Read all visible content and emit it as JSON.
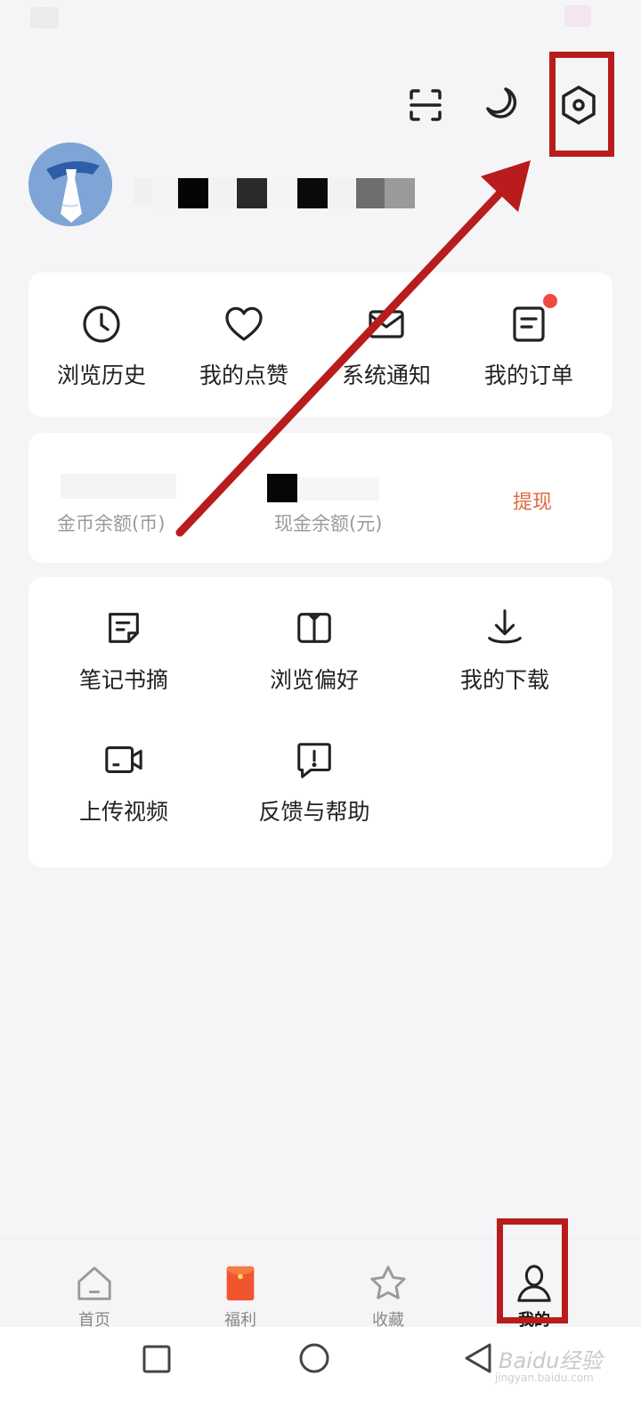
{
  "header": {
    "username_masked": "",
    "icons": [
      "scan-icon",
      "moon-icon",
      "settings-icon"
    ]
  },
  "quick_actions": [
    {
      "label": "浏览历史",
      "icon": "clock-icon"
    },
    {
      "label": "我的点赞",
      "icon": "heart-icon"
    },
    {
      "label": "系统通知",
      "icon": "mail-icon"
    },
    {
      "label": "我的订单",
      "icon": "order-icon",
      "badge": true
    }
  ],
  "wallet": {
    "coin_label": "金币余额(币)",
    "cash_label": "现金余额(元)",
    "withdraw_label": "提现"
  },
  "features": [
    {
      "label": "笔记书摘",
      "icon": "note-icon"
    },
    {
      "label": "浏览偏好",
      "icon": "book-icon"
    },
    {
      "label": "我的下载",
      "icon": "download-icon"
    },
    {
      "label": "上传视频",
      "icon": "video-icon"
    },
    {
      "label": "反馈与帮助",
      "icon": "feedback-icon"
    }
  ],
  "tabbar": [
    {
      "label": "首页",
      "icon": "home-icon"
    },
    {
      "label": "福利",
      "icon": "gift-envelope-icon"
    },
    {
      "label": "收藏",
      "icon": "star-icon"
    },
    {
      "label": "我的",
      "icon": "person-icon",
      "active": true
    }
  ],
  "watermark": {
    "text1": "Baidu经验",
    "text2": "jingyan.baidu.com"
  },
  "colors": {
    "background": "#f5f5f7",
    "accent_orange": "#e26a3c",
    "badge_red": "#f04a43",
    "annotation_red": "#b81c1c",
    "avatar_blue": "#7ea5d6"
  }
}
